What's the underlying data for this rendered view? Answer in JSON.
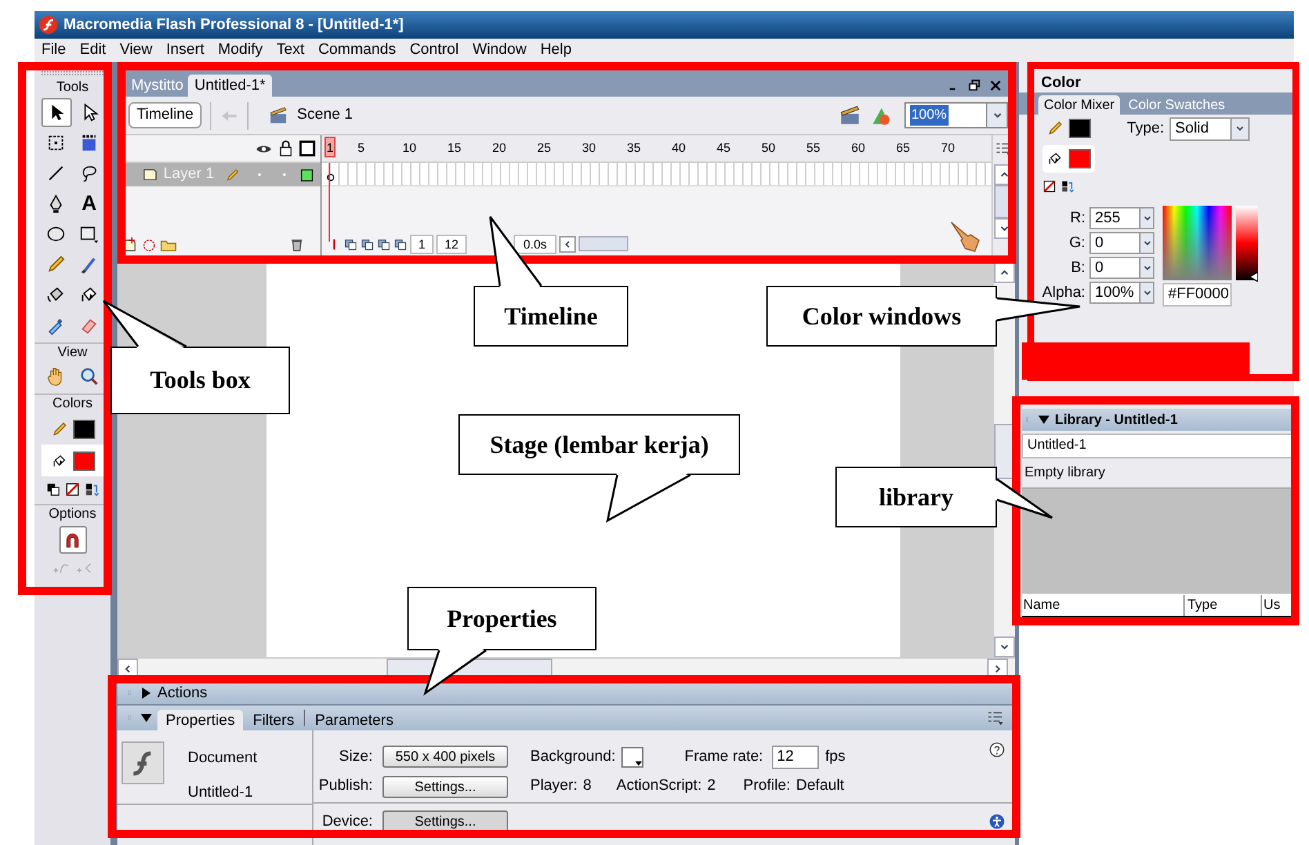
{
  "window": {
    "title": "Macromedia Flash Professional 8 - [Untitled-1*]"
  },
  "menu": [
    "File",
    "Edit",
    "View",
    "Insert",
    "Modify",
    "Text",
    "Commands",
    "Control",
    "Window",
    "Help"
  ],
  "tools_panel": {
    "title": "Tools",
    "tools": [
      {
        "kind": "arrow",
        "selected": true
      },
      {
        "kind": "subselect",
        "selected": false
      },
      {
        "kind": "free-transform",
        "selected": false
      },
      {
        "kind": "gradient-transform",
        "selected": false
      },
      {
        "kind": "line",
        "selected": false
      },
      {
        "kind": "lasso",
        "selected": false
      },
      {
        "kind": "pen",
        "selected": false
      },
      {
        "kind": "text",
        "glyph": "A",
        "selected": false
      },
      {
        "kind": "oval",
        "selected": false
      },
      {
        "kind": "rectangle",
        "selected": false
      },
      {
        "kind": "pencil",
        "selected": false
      },
      {
        "kind": "brush",
        "selected": false
      },
      {
        "kind": "ink-bottle",
        "selected": false
      },
      {
        "kind": "paint-bucket",
        "selected": false
      },
      {
        "kind": "eyedropper",
        "selected": false
      },
      {
        "kind": "eraser",
        "selected": false
      }
    ],
    "view_label": "View",
    "view_tools": [
      {
        "kind": "hand",
        "selected": false
      },
      {
        "kind": "zoom",
        "selected": false
      }
    ],
    "colors_label": "Colors",
    "swatches": [
      {
        "kind": "stroke",
        "color": "#000000"
      },
      {
        "kind": "fill",
        "color": "#ff0000"
      }
    ],
    "options_label": "Options"
  },
  "documents": [
    {
      "label": "Mystitto",
      "selected": false
    },
    {
      "label": "Untitled-1*",
      "selected": true
    }
  ],
  "timeline": {
    "button": "Timeline",
    "scene": "Scene 1",
    "zoom": "100%",
    "frame_numbers": [
      "1",
      "5",
      "10",
      "15",
      "20",
      "25",
      "30",
      "35",
      "40",
      "45",
      "50",
      "55",
      "60",
      "65",
      "70"
    ],
    "layers": [
      {
        "name": "Layer 1",
        "selected": true
      }
    ],
    "current_frame": "1",
    "frame_rate": "12",
    "elapsed": "0.0s"
  },
  "color_panel": {
    "title": "Color",
    "tabs": [
      {
        "label": "Color Mixer",
        "selected": true
      },
      {
        "label": "Color Swatches",
        "selected": false
      }
    ],
    "swatches": [
      {
        "kind": "stroke",
        "color": "#000000"
      },
      {
        "kind": "fill",
        "color": "#ff0000"
      }
    ],
    "type_label": "Type:",
    "type": "Solid",
    "channels": [
      {
        "label": "R:",
        "value": "255"
      },
      {
        "label": "G:",
        "value": "0"
      },
      {
        "label": "B:",
        "value": "0"
      },
      {
        "label": "Alpha:",
        "value": "100%"
      }
    ],
    "hex": "#FF0000",
    "brightness": {
      "level": 0.05
    }
  },
  "library_panel": {
    "title": "Library - Untitled-1",
    "expanded": true,
    "document": "Untitled-1",
    "status": "Empty library",
    "columns": [
      "Name",
      "Type",
      "Us"
    ]
  },
  "actions_panel": {
    "title": "Actions",
    "expanded": false
  },
  "properties_panel": {
    "expanded": true,
    "tabs": [
      {
        "label": "Properties",
        "selected": true
      },
      {
        "label": "Filters",
        "selected": false
      },
      {
        "label": "Parameters",
        "selected": false
      }
    ],
    "document_label": "Document",
    "document_name": "Untitled-1",
    "size": {
      "label": "Size:",
      "value": "550 x 400 pixels"
    },
    "background_label": "Background:",
    "frame_rate": {
      "label": "Frame rate:",
      "value": "12",
      "unit": "fps"
    },
    "publish": {
      "label": "Publish:",
      "button": "Settings..."
    },
    "player": {
      "label": "Player:",
      "value": "8"
    },
    "actionscript": {
      "label": "ActionScript:",
      "value": "2"
    },
    "profile": {
      "label": "Profile:",
      "value": "Default"
    },
    "device": {
      "label": "Device:",
      "button": "Settings..."
    }
  },
  "annotations": [
    {
      "text": "Timeline"
    },
    {
      "text": "Color windows"
    },
    {
      "text": "Tools box"
    },
    {
      "text": "Stage (lembar kerja)"
    },
    {
      "text": "library"
    },
    {
      "text": "Properties"
    }
  ]
}
